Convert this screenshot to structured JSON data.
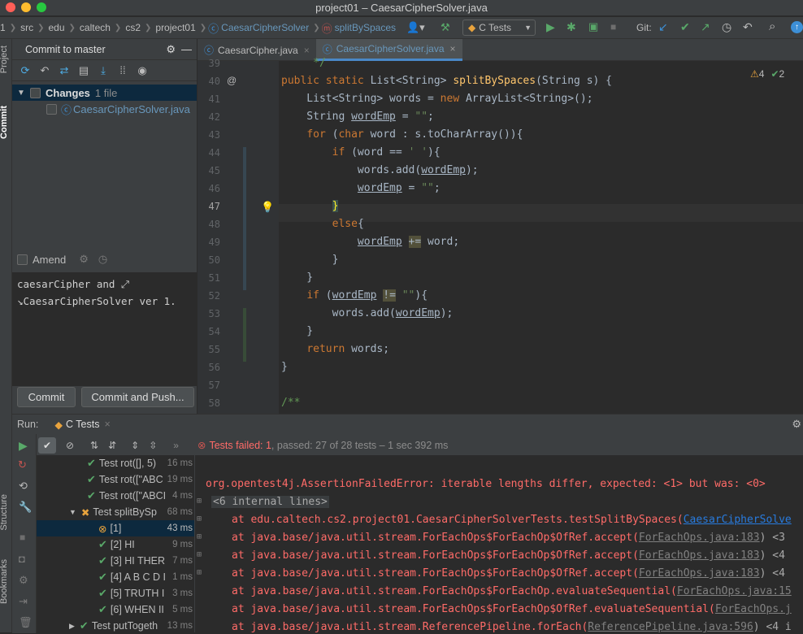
{
  "window": {
    "title": "project01 – CaesarCipherSolver.java"
  },
  "breadcrumbs": [
    "src",
    "edu",
    "caltech",
    "cs2",
    "project01",
    "CaesarCipherSolver",
    "splitBySpaces"
  ],
  "breadcrumb_first_fragment": "1",
  "run_config": {
    "label": "C Tests"
  },
  "git_label": "Git:",
  "left_strip": {
    "project": "Project",
    "commit": "Commit",
    "structure": "Structure",
    "bookmarks": "Bookmarks"
  },
  "commit_panel": {
    "title": "Commit to master",
    "changes_label": "Changes",
    "changes_count": "1 file",
    "file": "CaesarCipherSolver.java",
    "amend_label": "Amend",
    "message_line1": "caesarCipher and",
    "message_line2": "CaesarCipherSolver ver 1.",
    "commit_button": "Commit",
    "commit_push_button": "Commit and Push..."
  },
  "editor": {
    "tabs": [
      {
        "label": "CaesarCipher.java"
      },
      {
        "label": "CaesarCipherSolver.java"
      }
    ],
    "warnings": "4",
    "weak_warnings": "2",
    "line_numbers": [
      "39",
      "40",
      "41",
      "42",
      "43",
      "44",
      "45",
      "46",
      "47",
      "48",
      "49",
      "50",
      "51",
      "52",
      "53",
      "54",
      "55",
      "56",
      "57",
      "58"
    ]
  },
  "run_panel": {
    "label": "Run:",
    "tab": "C Tests",
    "status_failed": "Tests failed: 1",
    "status_rest": ", passed: 27 of 28 tests – 1 sec 392 ms",
    "tests": [
      {
        "name": "Test rot([], 5)",
        "time": "16 ms"
      },
      {
        "name": "Test rot([\"ABC",
        "time": "19 ms"
      },
      {
        "name": "Test rot([\"ABCI",
        "time": "4 ms"
      },
      {
        "name": "Test splitBySp",
        "time": "68 ms"
      },
      {
        "name": "[1]",
        "time": "43 ms"
      },
      {
        "name": "[2] HI",
        "time": "9 ms"
      },
      {
        "name": "[3] HI THER",
        "time": "7 ms"
      },
      {
        "name": "[4] A B C D I",
        "time": "1 ms"
      },
      {
        "name": "[5] TRUTH I",
        "time": "3 ms"
      },
      {
        "name": "[6] WHEN II",
        "time": "5 ms"
      },
      {
        "name": "Test putTogeth",
        "time": "13 ms"
      }
    ],
    "console": {
      "error": "org.opentest4j.AssertionFailedError: iterable lengths differ, expected: <1> but was: <0>",
      "internal": "<6 internal lines>",
      "frames": [
        {
          "text": "at edu.caltech.cs2.project01.CaesarCipherSolverTests.testSplitBySpaces(",
          "link": "CaesarCipherSolve",
          "suffix": ""
        },
        {
          "text": "at java.base/java.util.stream.ForEachOps$ForEachOp$OfRef.accept(",
          "link": "ForEachOps.java:183",
          "suffix": ") <3"
        },
        {
          "text": "at java.base/java.util.stream.ForEachOps$ForEachOp$OfRef.accept(",
          "link": "ForEachOps.java:183",
          "suffix": ") <4"
        },
        {
          "text": "at java.base/java.util.stream.ForEachOps$ForEachOp$OfRef.accept(",
          "link": "ForEachOps.java:183",
          "suffix": ") <4"
        },
        {
          "text": "at java.base/java.util.stream.ForEachOps$ForEachOp.evaluateSequential(",
          "link": "ForEachOps.java:15",
          "suffix": ""
        },
        {
          "text": "at java.base/java.util.stream.ForEachOps$ForEachOp$OfRef.evaluateSequential(",
          "link": "ForEachOps.j",
          "suffix": ""
        },
        {
          "text": "at java.base/java.util.stream.ReferencePipeline.forEach(",
          "link": "ReferencePipeline.java:596",
          "suffix": ") <4 i"
        }
      ]
    }
  },
  "colors": {
    "accent": "#4a88c7",
    "error": "#ff6b68",
    "success": "#59a869",
    "keyword": "#cc7832"
  }
}
